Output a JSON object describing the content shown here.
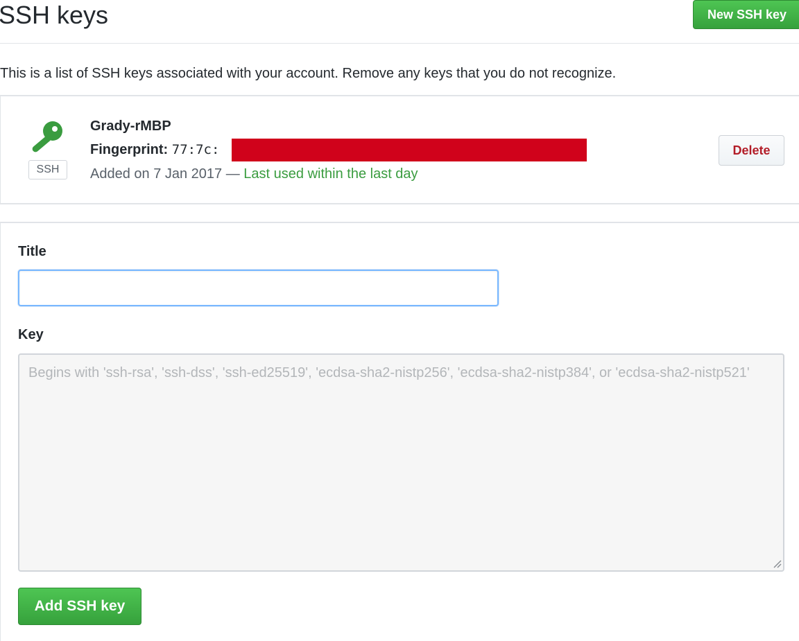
{
  "header": {
    "title": "SSH keys",
    "new_key_label": "New SSH key"
  },
  "intro": "This is a list of SSH keys associated with your account. Remove any keys that you do not recognize.",
  "keys": [
    {
      "badge": "SSH",
      "name": "Grady-rMBP",
      "fingerprint_label": "Fingerprint: ",
      "fingerprint_value": "77:7c:",
      "added": "Added on 7 Jan 2017 —",
      "last_used": "Last used within the last day",
      "delete_label": "Delete"
    }
  ],
  "form": {
    "title_label": "Title",
    "title_value": "",
    "key_label": "Key",
    "key_value": "",
    "key_placeholder": "Begins with 'ssh-rsa', 'ssh-dss', 'ssh-ed25519', 'ecdsa-sha2-nistp256', 'ecdsa-sha2-nistp384', or 'ecdsa-sha2-nistp521'",
    "submit_label": "Add SSH key"
  },
  "colors": {
    "primary_button": "#36a13c",
    "danger_text": "#b31d28",
    "last_used_text": "#3a9c3f",
    "key_icon": "#3a9c3f",
    "redaction": "#d0021b",
    "focus_border": "#79b8ff"
  },
  "icons": {
    "key": "key-icon",
    "resize": "resize-handle-icon"
  }
}
